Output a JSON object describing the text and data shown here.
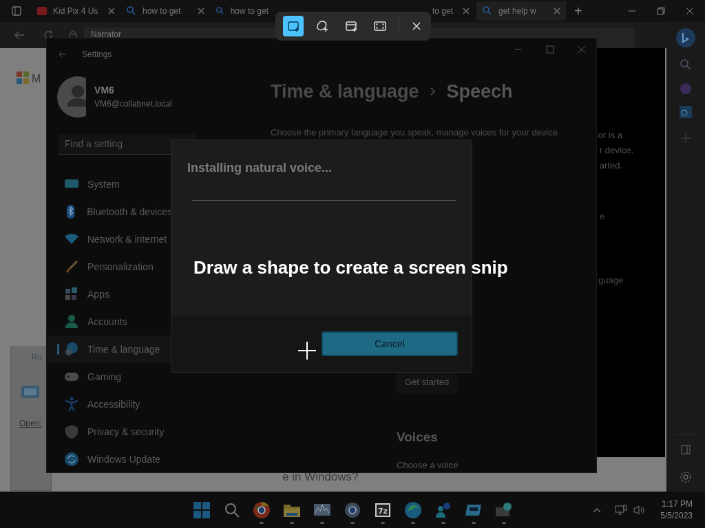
{
  "browser": {
    "tabs": [
      {
        "title": "Kid Pix 4 Us",
        "kind": "pdf",
        "selected": false,
        "close_button": true
      },
      {
        "title": "how to get",
        "kind": "search",
        "selected": false,
        "close_button": true
      },
      {
        "title": "how to get",
        "kind": "search",
        "selected": false,
        "close_button": false
      },
      {
        "title": "to get",
        "kind": "partial",
        "selected": false,
        "close_button": true
      },
      {
        "title": "get help w",
        "kind": "search",
        "selected": true,
        "close_button": true
      }
    ],
    "new_tab": "+",
    "page_logo_text": "M",
    "page_fragments": [
      "or is a",
      "r device.",
      "arted."
    ],
    "bottom_fragment": "e in Windows?"
  },
  "narrator_window": {
    "title": "Narrator"
  },
  "run_dialog": {
    "title": "Ru",
    "open_label": "Open:"
  },
  "snip_toolbar": {
    "modes": [
      {
        "kind": "rectangle",
        "selected": true
      },
      {
        "kind": "freeform",
        "selected": false
      },
      {
        "kind": "window",
        "selected": false
      },
      {
        "kind": "fullscreen",
        "selected": false
      }
    ]
  },
  "settings": {
    "title": "Settings",
    "user": {
      "name": "VM6",
      "email": "VM6@collabnet.local"
    },
    "search": {
      "placeholder": "Find a setting"
    },
    "nav": [
      {
        "label": "System",
        "kind": "system",
        "selected": false
      },
      {
        "label": "Bluetooth & devices",
        "kind": "bluetooth",
        "selected": false
      },
      {
        "label": "Network & internet",
        "kind": "network",
        "selected": false
      },
      {
        "label": "Personalization",
        "kind": "brush",
        "selected": false
      },
      {
        "label": "Apps",
        "kind": "apps",
        "selected": false
      },
      {
        "label": "Accounts",
        "kind": "person",
        "selected": false
      },
      {
        "label": "Time & language",
        "kind": "clock",
        "selected": true
      },
      {
        "label": "Gaming",
        "kind": "gamepad",
        "selected": false
      },
      {
        "label": "Accessibility",
        "kind": "accessibility",
        "selected": false
      },
      {
        "label": "Privacy & security",
        "kind": "shield",
        "selected": false
      },
      {
        "label": "Windows Update",
        "kind": "update",
        "selected": false
      }
    ],
    "breadcrumb": [
      "Time & language",
      "Speech"
    ],
    "description": "Choose the primary language you speak, manage voices for your device",
    "fragments": [
      "e",
      "guage"
    ],
    "get_started": "Get started",
    "voices_heading": "Voices",
    "choose_voice": "Choose a voice"
  },
  "dialog": {
    "title": "Installing natural voice...",
    "button": "Cancel"
  },
  "snip_hint": "Draw a shape to create a screen snip",
  "taskbar": {
    "apps": [
      {
        "kind": "chrome"
      },
      {
        "kind": "folder"
      },
      {
        "kind": "monitor"
      },
      {
        "kind": "gear"
      },
      {
        "kind": "archive",
        "label": "7z"
      },
      {
        "kind": "edge"
      },
      {
        "kind": "people"
      },
      {
        "kind": "card"
      },
      {
        "kind": "remote"
      }
    ],
    "time": "1:17 PM",
    "date": "5/5/2023"
  }
}
